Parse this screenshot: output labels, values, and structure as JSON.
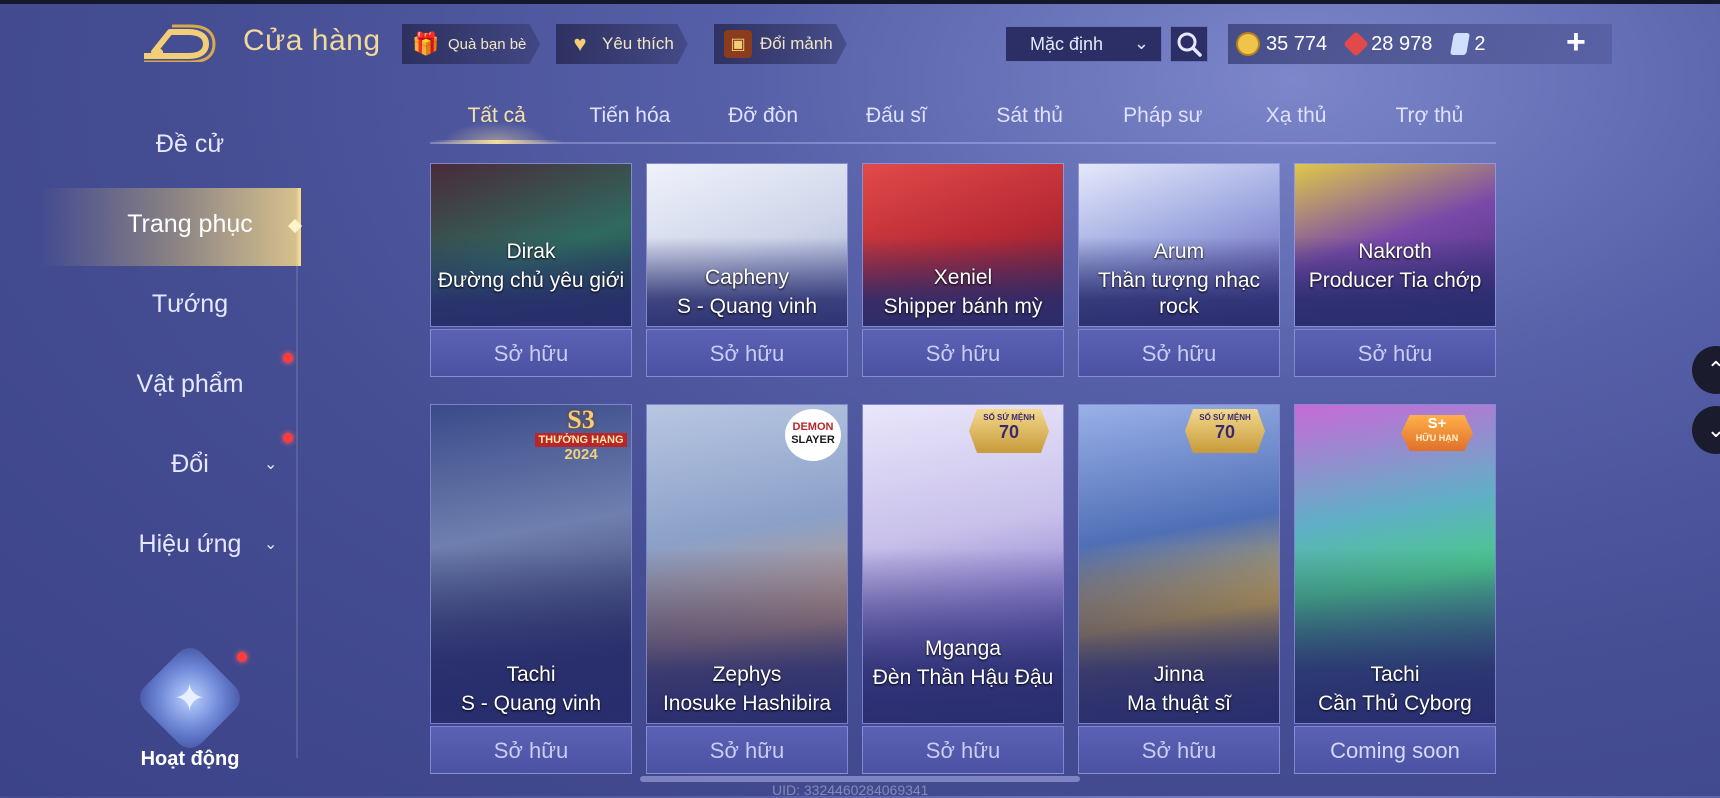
{
  "header": {
    "title": "Cửa hàng",
    "pills": [
      {
        "label": "Quà bạn bè",
        "icon": "gift-icon"
      },
      {
        "label": "Yêu thích",
        "icon": "heart-icon"
      },
      {
        "label": "Đổi mảnh",
        "icon": "fragment-chest-icon"
      }
    ],
    "sort": {
      "selected": "Mặc định"
    },
    "currencies": [
      {
        "icon": "gold-coin-icon",
        "value": "35 774"
      },
      {
        "icon": "voucher-gem-icon",
        "value": "28 978"
      },
      {
        "icon": "skin-card-icon",
        "value": "2"
      }
    ],
    "plus_label": "+"
  },
  "sidebar": {
    "items": [
      {
        "label": "Đề cử"
      },
      {
        "label": "Trang phục",
        "active": true
      },
      {
        "label": "Tướng"
      },
      {
        "label": "Vật phẩm"
      },
      {
        "label": "Đổi"
      },
      {
        "label": "Hiệu ứng"
      }
    ],
    "activity_label": "Hoạt động"
  },
  "tabs": [
    "Tất cả",
    "Tiến hóa",
    "Đỡ đòn",
    "Đấu sĩ",
    "Sát thủ",
    "Pháp sư",
    "Xạ thủ",
    "Trợ thủ"
  ],
  "row1": [
    {
      "hero": "Dirak",
      "skin": "Đường chủ yêu giới",
      "button": "Sở hữu",
      "color": "#2f6a5e"
    },
    {
      "hero": "Capheny",
      "skin": "S - Quang vinh",
      "button": "Sở hữu",
      "color": "#cfd6ea"
    },
    {
      "hero": "Xeniel",
      "skin": "Shipper bánh mỳ",
      "button": "Sở hữu",
      "color": "#b82a34"
    },
    {
      "hero": "Arum",
      "skin": "Thần tượng nhạc rock",
      "button": "Sở hữu",
      "color": "#9ea8e0"
    },
    {
      "hero": "Nakroth",
      "skin": "Producer Tia chớp",
      "button": "Sở hữu",
      "color": "#7a4aa8"
    }
  ],
  "row2": [
    {
      "hero": "Tachi",
      "skin": "S - Quang vinh",
      "button": "Sở hữu",
      "color": "#6f7fae",
      "badge_top": "S3",
      "badge_mid": "THƯỞNG HẠNG",
      "badge_bot": "2024"
    },
    {
      "hero": "Zephys",
      "skin": "Inosuke Hashibira",
      "button": "Sở hữu",
      "color": "#8ba0c8",
      "badge_top": "DEMON",
      "badge_mid": "SLAYER",
      "badge_bot": ""
    },
    {
      "hero": "Mganga",
      "skin": "Đèn Thần Hậu Đậu",
      "button": "Sở hữu",
      "color": "#c8c0ea",
      "badge_top": "SỐ SỨ MỆNH",
      "badge_mid": "70",
      "badge_bot": ""
    },
    {
      "hero": "Jinna",
      "skin": "Ma thuật sĩ",
      "button": "Sở hữu",
      "color": "#4f6fb6",
      "badge_top": "SỐ SỨ MỆNH",
      "badge_mid": "70",
      "badge_bot": ""
    },
    {
      "hero": "Tachi",
      "skin": "Cần Thủ Cyborg",
      "button": "Coming soon",
      "color": "#5fb0c6",
      "badge_top": "S+",
      "badge_mid": "HỮU HẠN",
      "badge_bot": ""
    }
  ],
  "footer": {
    "uid": "UID: 3324460284069341"
  }
}
